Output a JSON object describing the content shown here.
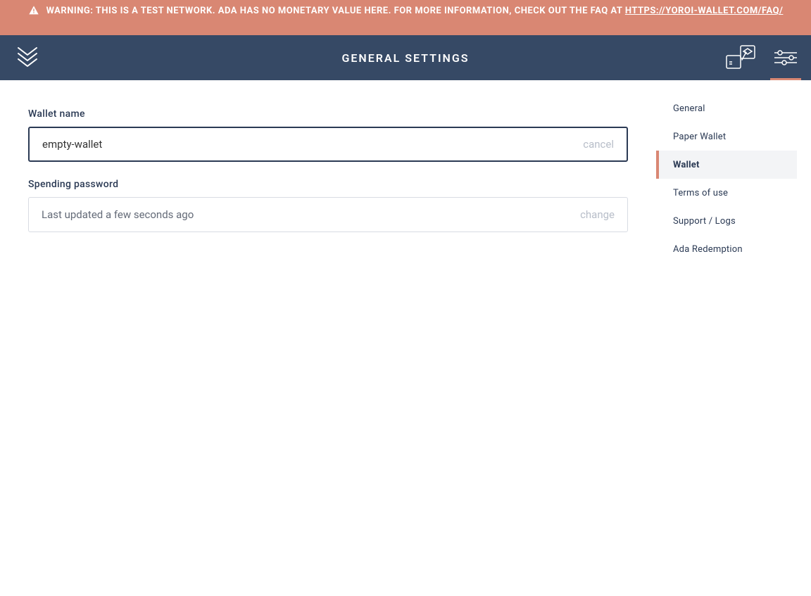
{
  "warning": {
    "prefix": "WARNING: THIS IS A TEST NETWORK. ADA HAS NO MONETARY VALUE HERE. FOR MORE INFORMATION, CHECK OUT THE FAQ AT ",
    "link_text": "HTTPS://YOROI-WALLET.COM/FAQ/"
  },
  "header": {
    "title": "GENERAL SETTINGS"
  },
  "wallet_name": {
    "label": "Wallet name",
    "value": "empty-wallet",
    "action": "cancel"
  },
  "spending_password": {
    "label": "Spending password",
    "value": "Last updated a few seconds ago",
    "action": "change"
  },
  "sidebar": {
    "items": [
      {
        "label": "General",
        "active": false
      },
      {
        "label": "Paper Wallet",
        "active": false
      },
      {
        "label": "Wallet",
        "active": true
      },
      {
        "label": "Terms of use",
        "active": false
      },
      {
        "label": "Support / Logs",
        "active": false
      },
      {
        "label": "Ada Redemption",
        "active": false
      }
    ]
  }
}
